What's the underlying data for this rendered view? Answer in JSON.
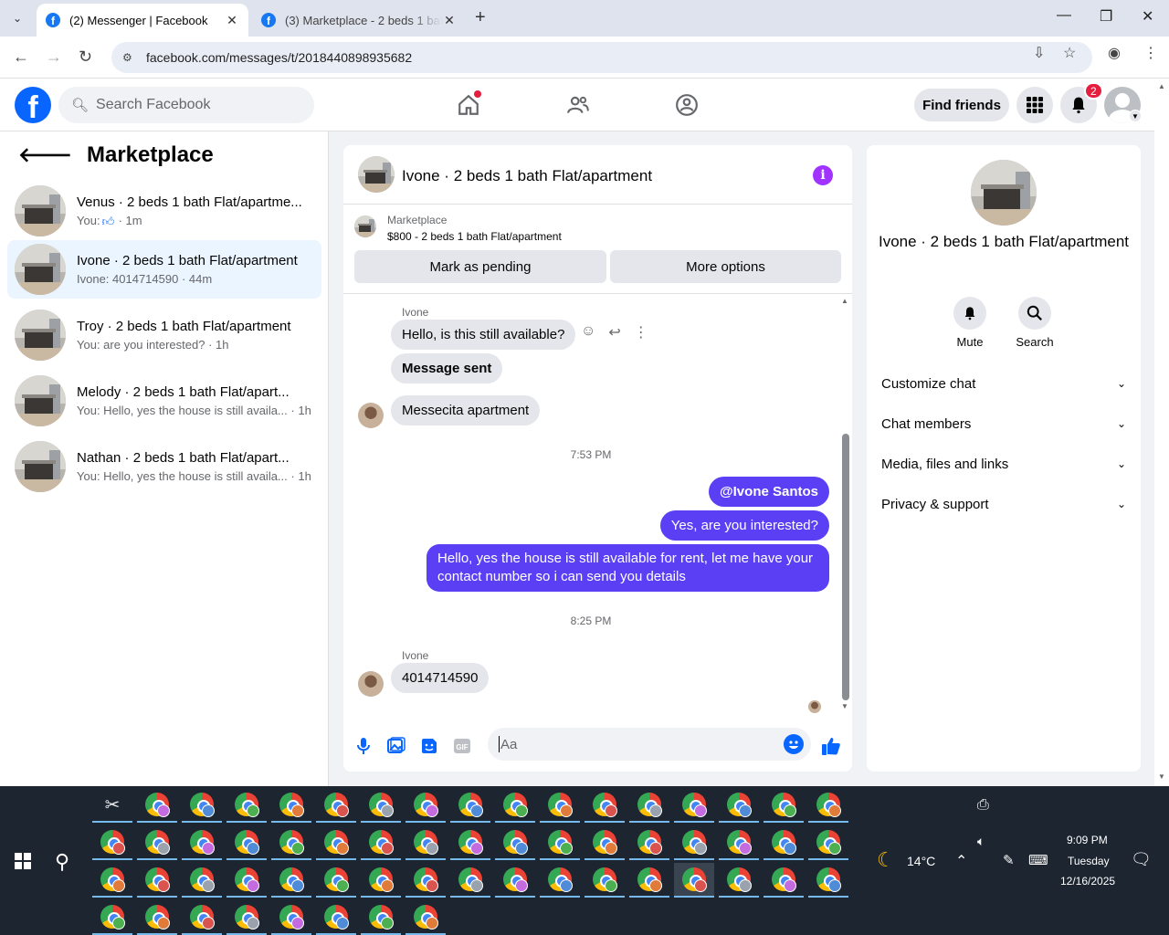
{
  "browser": {
    "tabs": [
      {
        "title": "(2) Messenger | Facebook",
        "active": true
      },
      {
        "title": "(3) Marketplace - 2 beds 1 bath",
        "active": false
      }
    ],
    "url": "facebook.com/messages/t/2018440898935682"
  },
  "fb_header": {
    "search_placeholder": "Search Facebook",
    "find_friends_label": "Find friends",
    "notification_count": "2",
    "brand_color": "#0866ff"
  },
  "sidebar": {
    "title": "Marketplace",
    "conversations": [
      {
        "name": "Venus · 2 beds 1 bath Flat/apartme...",
        "prefix": "You:",
        "has_like": true,
        "preview": "",
        "time": "· 1m",
        "selected": false
      },
      {
        "name": "Ivone · 2 beds 1 bath Flat/apartment",
        "prefix": "Ivone:",
        "has_like": false,
        "preview": " 4014714590",
        "time": " · 44m",
        "selected": true
      },
      {
        "name": "Troy · 2 beds 1 bath Flat/apartment",
        "prefix": "You:",
        "has_like": false,
        "preview": " are you interested?",
        "time": " · 1h",
        "selected": false
      },
      {
        "name": "Melody · 2 beds 1 bath Flat/apart...",
        "prefix": "You:",
        "has_like": false,
        "preview": " Hello, yes the house is still availa...",
        "time": " · 1h",
        "selected": false
      },
      {
        "name": "Nathan · 2 beds 1 bath Flat/apart...",
        "prefix": "You:",
        "has_like": false,
        "preview": " Hello, yes the house is still availa...",
        "time": " · 1h",
        "selected": false
      }
    ]
  },
  "chat": {
    "title": "Ivone · 2 beds 1 bath Flat/apartment",
    "marketplace_label": "Marketplace",
    "listing": "$800 - 2 beds 1 bath Flat/apartment",
    "mark_pending_label": "Mark as pending",
    "more_options_label": "More options",
    "sender_name": "Ivone",
    "messages_in_1": [
      "Hello, is this still available?",
      "Message sent",
      "Messecita apartment"
    ],
    "time_1": "7:53 PM",
    "messages_out": [
      "@Ivone Santos",
      "Yes, are you interested?",
      "Hello, yes the house is still available for rent, let me have your contact number so i can send you details"
    ],
    "time_2": "8:25 PM",
    "message_in_2": "4014714590",
    "composer_placeholder": "Aa",
    "outgoing_color": "#5b3ff5"
  },
  "details": {
    "title": "Ivone · 2 beds 1 bath Flat/apartment",
    "mute_label": "Mute",
    "search_label": "Search",
    "sections": [
      "Customize chat",
      "Chat members",
      "Media, files and links",
      "Privacy & support"
    ]
  },
  "taskbar": {
    "weather": "14°C",
    "time": "9:09 PM",
    "day": "Tuesday",
    "date": "12/16/2025"
  }
}
